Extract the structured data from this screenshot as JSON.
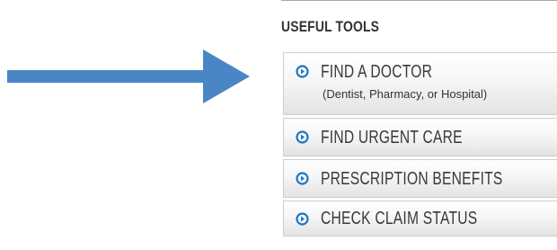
{
  "panel": {
    "title": "USEFUL TOOLS"
  },
  "tools": [
    {
      "label": "FIND A DOCTOR",
      "sublabel": "(Dentist, Pharmacy, or Hospital)",
      "icon": "circle-chevron-right-icon"
    },
    {
      "label": "FIND URGENT CARE",
      "icon": "circle-chevron-right-icon"
    },
    {
      "label": "PRESCRIPTION BENEFITS",
      "icon": "circle-chevron-right-icon"
    },
    {
      "label": "CHECK CLAIM STATUS",
      "icon": "circle-chevron-right-icon"
    }
  ],
  "colors": {
    "arrow": "#4a86c6",
    "icon": "#1f78c1",
    "text": "#3a3a3a",
    "border": "#cdcdcd"
  }
}
